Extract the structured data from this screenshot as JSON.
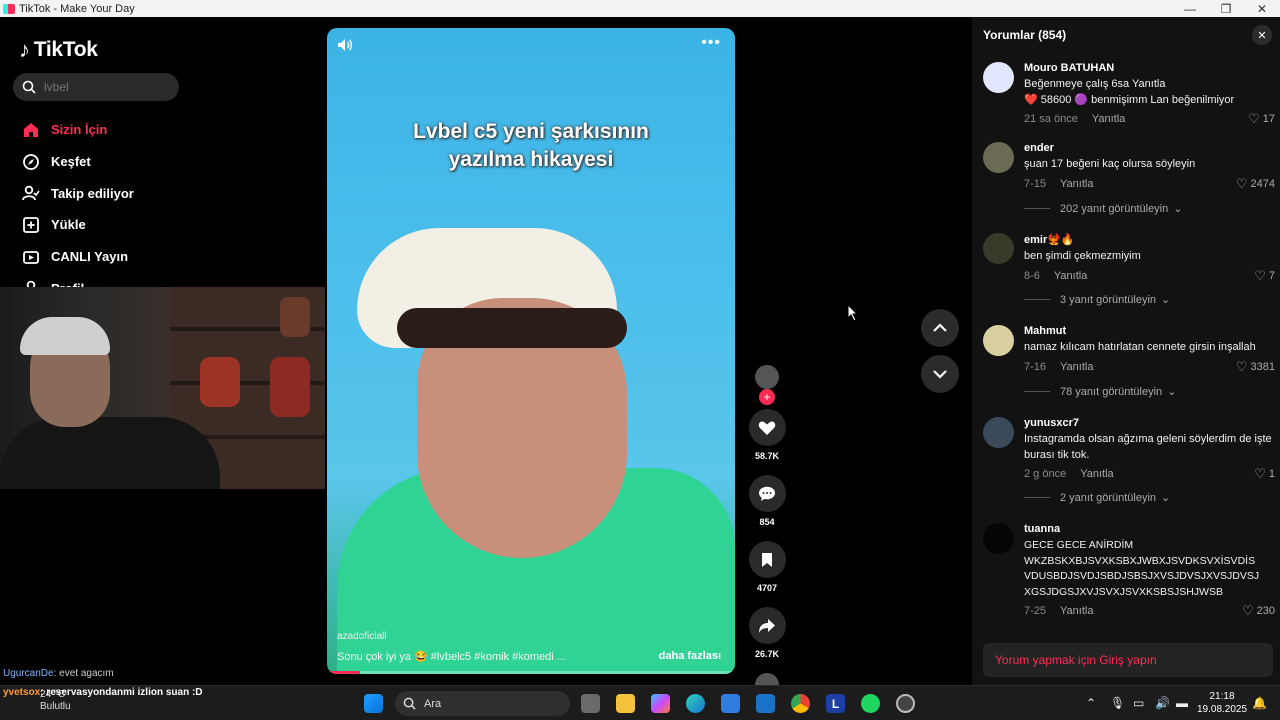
{
  "window": {
    "title": "TikTok - Make Your Day",
    "minimize": "—",
    "maximize": "❐",
    "close": "✕"
  },
  "sidebar": {
    "logo": "TikTok",
    "search_placeholder": "lvbel",
    "items": [
      {
        "label": "Sizin İçin",
        "icon": "home-icon"
      },
      {
        "label": "Keşfet",
        "icon": "compass-icon"
      },
      {
        "label": "Takip ediliyor",
        "icon": "following-icon"
      },
      {
        "label": "Yükle",
        "icon": "upload-icon"
      },
      {
        "label": "CANLI Yayın",
        "icon": "live-icon"
      },
      {
        "label": "Profil",
        "icon": "profile-icon"
      }
    ]
  },
  "stream_chat": {
    "line1_user": "UgurcanDe",
    "line1_text": ": evet agacım",
    "line2_user": "yvetsox",
    "line2_text": ": reservasyondanmi izlion suan :D"
  },
  "video": {
    "caption_line1": "Lvbel c5 yeni şarkısının",
    "caption_line2": "yazılma hikayesi",
    "author": "azadoficiall",
    "description": "Sonu çok iyi ya 😂 #lvbelc5  #komik  #komedi  ...",
    "more_label": "daha fazlası",
    "progress": 0.08
  },
  "actions": {
    "likes": "58.7K",
    "comments": "854",
    "saves": "4707",
    "shares": "26.7K"
  },
  "comments_panel": {
    "title": "Yorumlar (854)",
    "reply_label": "Yanıtla",
    "login_prompt": "Yorum yapmak için Giriş yapın",
    "items": [
      {
        "user": "Mouro BATUHAN",
        "text": "Beğenmeye çalış            6sa         Yanıtla",
        "text2": "❤️ 58600            🟣 benmişimm Lan beğenilmiyor",
        "time": "21 sa önce",
        "likes": "17",
        "replies": ""
      },
      {
        "user": "ender",
        "text": "şuan 17 beğeni kaç olursa söyleyin",
        "text2": "",
        "time": "7-15",
        "likes": "2474",
        "replies": "202 yanıt görüntüleyin"
      },
      {
        "user": "emir🐦‍🔥🔥",
        "text": "ben şimdi çekmezmiyim",
        "text2": "",
        "time": "8-6",
        "likes": "7",
        "replies": "3 yanıt görüntüleyin"
      },
      {
        "user": "Mahmut",
        "text": "namaz kılıcam hatırlatan cennete girsin inşallah",
        "text2": "",
        "time": "7-16",
        "likes": "3381",
        "replies": "78 yanıt görüntüleyin"
      },
      {
        "user": "yunusxcr7",
        "text": "Instagramda olsan ağzıma geleni söylerdim de işte burası tik tok.",
        "text2": "",
        "time": "2 g önce",
        "likes": "1",
        "replies": "2 yanıt görüntüleyin"
      },
      {
        "user": "tuanna",
        "text": "GECE GECE ANİRDİM WKZBSKXBJSVXKSBXJWBXJSVDKSVXİSVDİS VDUSBDJSVDJSBDJSBSJXVSJDVSJXVSJDVSJ XGSJDGSJXVJSVXJSVXKSBSJSHJWSB",
        "text2": "",
        "time": "7-25",
        "likes": "230",
        "replies": ""
      }
    ]
  },
  "taskbar": {
    "search_label": "Ara",
    "time": "21:18",
    "date": "19.08.2025",
    "weather_temp": "24 °C",
    "weather_text": "Bulutlu"
  }
}
